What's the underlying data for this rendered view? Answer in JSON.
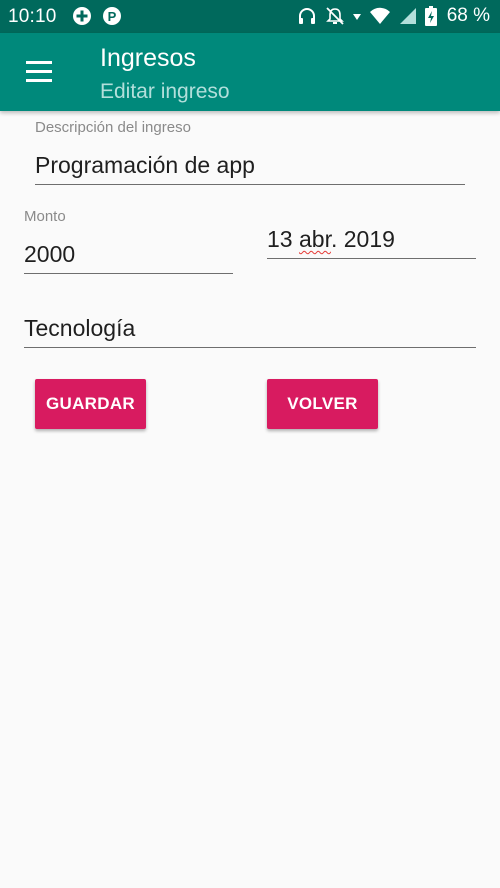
{
  "status_bar": {
    "time": "10:10",
    "battery_text": "68 %",
    "icons": [
      "plus-circle-icon",
      "p-badge-icon",
      "headphones-icon",
      "bell-off-icon",
      "wifi-icon",
      "signal-icon",
      "battery-charging-icon"
    ]
  },
  "app_bar": {
    "title": "Ingresos",
    "subtitle": "Editar ingreso",
    "menu_icon": "hamburger-menu-icon"
  },
  "form": {
    "description": {
      "label": "Descripción del ingreso",
      "value": "Programación de app"
    },
    "amount": {
      "label": "Monto",
      "value": "2000"
    },
    "date": {
      "day": "13",
      "month": "abr",
      "rest": ". 2019"
    },
    "category": {
      "value": "Tecnología"
    }
  },
  "buttons": {
    "save": "GUARDAR",
    "back": "VOLVER"
  },
  "colors": {
    "status_bar": "#00695c",
    "app_bar": "#00897b",
    "accent": "#d81b60",
    "subtitle": "#b2dfdb",
    "background": "#fafafa"
  }
}
